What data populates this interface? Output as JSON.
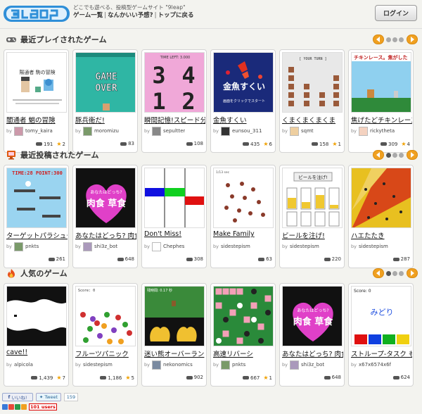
{
  "header": {
    "tagline": "どこでも遊べる、投稿型ゲームサイト \"9leap\"",
    "nav": [
      "ゲーム一覧",
      "なんかいい予感?",
      "トップに戻る"
    ],
    "login_label": "ログイン",
    "logo_text": "9leap"
  },
  "sections": [
    {
      "title": "最近プレイされたゲーム",
      "icon": "gamepad-icon",
      "cards": [
        {
          "title": "闇通者 魍の冒険",
          "author": "tomy_kaira",
          "plays": "191",
          "stars": "2",
          "thumb_text": "陽通者 駒の冒険"
        },
        {
          "title": "豚兵衛だ!",
          "author": "moromizu",
          "plays": "83",
          "stars": "",
          "thumb_text": "GAME OVER"
        },
        {
          "title": "瞬間記憶!スピード分",
          "author": "sepultter",
          "plays": "108",
          "stars": "",
          "thumb_text": "TIME LEFT: 3.000"
        },
        {
          "title": "金魚すくい",
          "author": "eunsou_311",
          "plays": "435",
          "stars": "6",
          "thumb_text": "画面をクリックでスタート"
        },
        {
          "title": "くまくまくまくま",
          "author": "sqmt",
          "plays": "158",
          "stars": "1",
          "thumb_text": "[ YOUR TURN ]"
        },
        {
          "title": "焦げたどチキンレース",
          "author": "rickytheta",
          "plays": "309",
          "stars": "4",
          "thumb_text": "チキンレース。焦がした"
        }
      ]
    },
    {
      "title": "最近投稿されたゲーム",
      "icon": "monitor-icon",
      "cards": [
        {
          "title": "ターゲットパラシュー",
          "author": "pnkts",
          "plays": "261",
          "stars": "",
          "thumb_text": "TIME:28 POINT:300"
        },
        {
          "title": "あなたはどっち? 肉食",
          "author": "shi3z_bot",
          "plays": "648",
          "stars": "",
          "thumb_text": "あなたはどっち? 肉食 or 草食"
        },
        {
          "title": "Don't Miss!",
          "author": "Chephes",
          "plays": "308",
          "stars": "",
          "thumb_text": ""
        },
        {
          "title": "Make Family",
          "author": "sidestepism",
          "plays": "63",
          "stars": "",
          "thumb_text": "1/13 sec"
        },
        {
          "title": "ビールを注げ!",
          "author": "sidestepism",
          "plays": "220",
          "stars": "",
          "thumb_text": "ビールを注げ!"
        },
        {
          "title": "ハエたたき",
          "author": "sidestepism",
          "plays": "287",
          "stars": "",
          "thumb_text": ""
        }
      ]
    },
    {
      "title": "人気のゲーム",
      "icon": "flame-icon",
      "cards": [
        {
          "title": "cave!!",
          "author": "alpicola",
          "plays": "1,439",
          "stars": "7",
          "thumb_text": ""
        },
        {
          "title": "フルーツパニック",
          "author": "sidestepism",
          "plays": "1,186",
          "stars": "5",
          "thumb_text": "Score: 0"
        },
        {
          "title": "迷い熊オーバーラン",
          "author": "nekonomics",
          "plays": "902",
          "stars": "",
          "thumb_text": "残時間: 0.17 秒"
        },
        {
          "title": "高速リバーシ",
          "author": "pnkts",
          "plays": "667",
          "stars": "1",
          "thumb_text": ""
        },
        {
          "title": "あなたはどっち? 肉食",
          "author": "shi3z_bot",
          "plays": "648",
          "stars": "",
          "thumb_text": "あなたはどっち? 肉食 or 草食"
        },
        {
          "title": "ストループ-タスク も",
          "author": "x67x6574x6f",
          "plays": "624",
          "stars": "",
          "thumb_text": "Score: 0 / みどり"
        }
      ]
    }
  ],
  "footer": {
    "facebook_label": "いいね!",
    "tweet_label": "Tweet",
    "tweet_count": "159",
    "users_badge": "101 users"
  },
  "colors": {
    "accent": "#f0a020",
    "background": "#f3f3ef",
    "logo_blue": "#2f8fd8"
  }
}
